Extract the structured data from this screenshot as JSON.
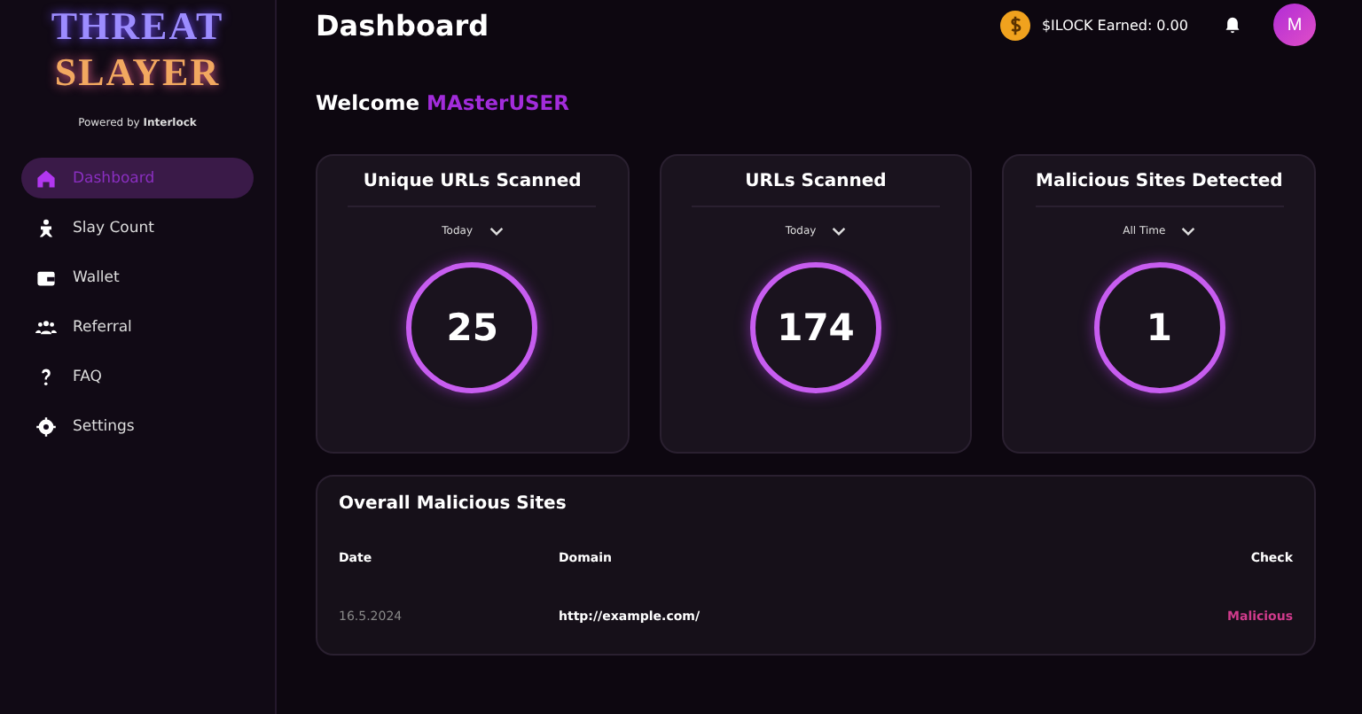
{
  "logo": {
    "line_1": "THREAT",
    "line_2": "SLAYER",
    "tagline": "Powered by **Interlock**"
  },
  "sidebar": {
    "items": [
      {
        "label": "Dashboard",
        "selected": true
      },
      {
        "label": "Slay Count",
        "selected": false
      },
      {
        "label": "Wallet",
        "selected": false
      },
      {
        "label": "Referral",
        "selected": false
      },
      {
        "label": "FAQ",
        "selected": false
      },
      {
        "label": "Settings",
        "selected": false
      }
    ]
  },
  "header": {
    "title": "Dashboard",
    "earned": "$ILOCK Earned: 0.00",
    "avatar": "M"
  },
  "welcome": {
    "text": "Welcome",
    "user": "MAsterUSER"
  },
  "stats": [
    {
      "title": "Unique URLs Scanned",
      "period": "Today",
      "value": "25"
    },
    {
      "title": "URLs Scanned",
      "period": "Today",
      "value": "174"
    },
    {
      "title": "Malicious Sites Detected",
      "period": "All Time",
      "value": "1"
    }
  ],
  "table": {
    "title": "Overall Malicious Sites",
    "columns": [
      "Date",
      "Domain",
      "Check"
    ],
    "rows": [
      [
        "16.5.2024",
        "http://example.com/",
        "Malicious"
      ]
    ]
  }
}
